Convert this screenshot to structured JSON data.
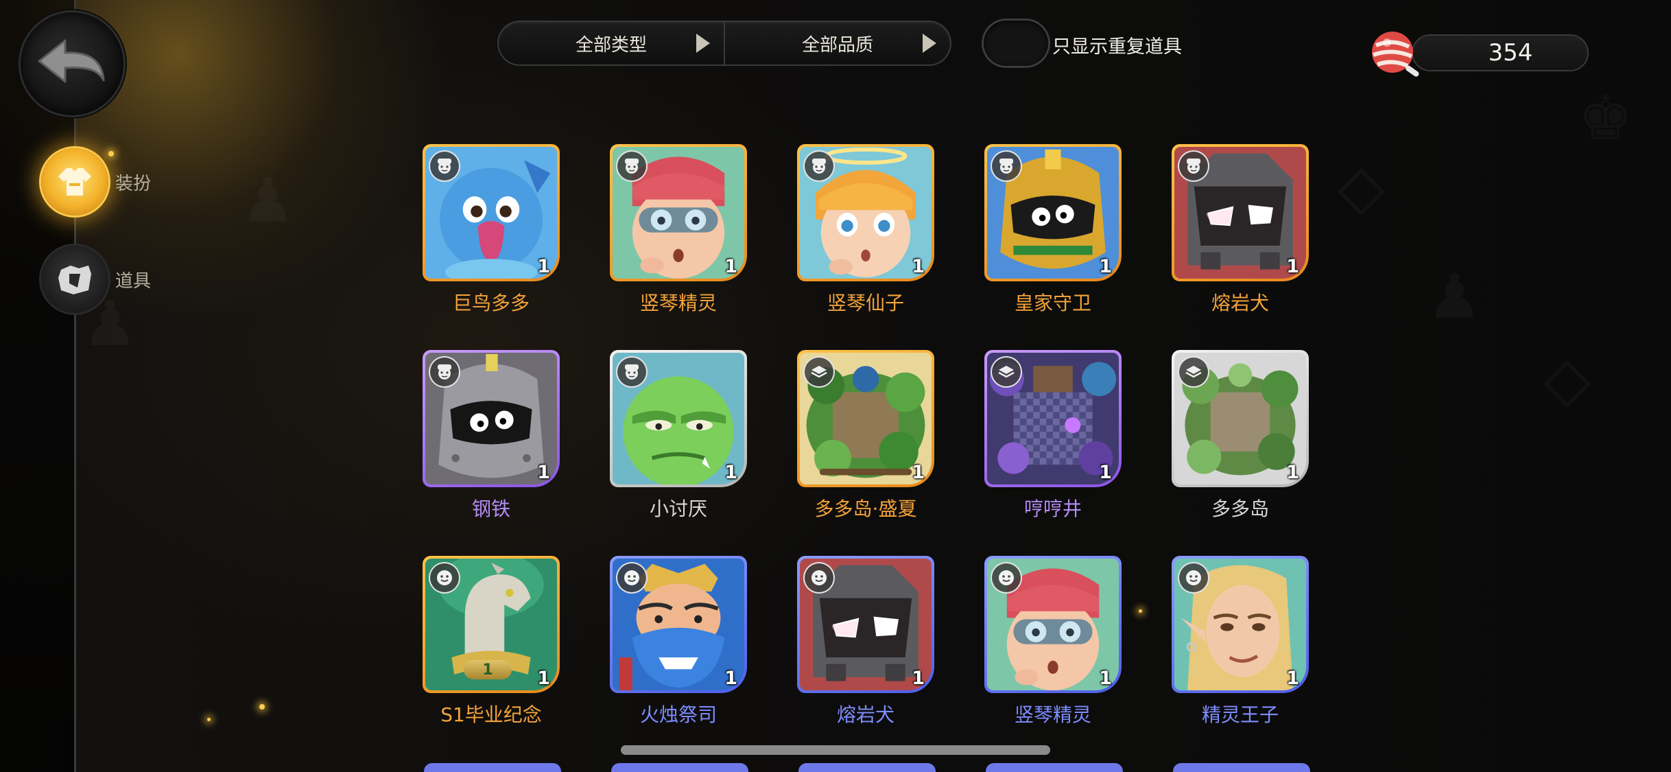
{
  "filters": {
    "type_label": "全部类型",
    "quality_label": "全部品质",
    "duplicate_toggle_label": "只显示重复道具",
    "duplicate_toggle_on": false
  },
  "currency": {
    "icon": "candy-icon",
    "value": "354"
  },
  "sidebar": {
    "items": [
      {
        "label": "装扮",
        "icon": "outfit-icon",
        "active": true
      },
      {
        "label": "道具",
        "icon": "item-bag-icon",
        "active": false
      }
    ]
  },
  "items": [
    {
      "name": "巨鸟多多",
      "count": "1",
      "quality": "orange",
      "badge": "avatar-face-icon",
      "art": "blue-bird"
    },
    {
      "name": "竖琴精灵",
      "count": "1",
      "quality": "orange",
      "badge": "avatar-face-icon",
      "art": "red-hair-elf"
    },
    {
      "name": "竖琴仙子",
      "count": "1",
      "quality": "orange",
      "badge": "avatar-face-icon",
      "art": "blonde-fairy"
    },
    {
      "name": "皇家守卫",
      "count": "1",
      "quality": "orange",
      "badge": "avatar-face-icon",
      "art": "gold-knight"
    },
    {
      "name": "熔岩犬",
      "count": "1",
      "quality": "orange",
      "badge": "avatar-face-icon",
      "art": "lava-hound"
    },
    {
      "name": "钢铁",
      "count": "1",
      "quality": "purple",
      "badge": "avatar-face-icon",
      "art": "steel-knight"
    },
    {
      "name": "小讨厌",
      "count": "1",
      "quality": "white",
      "badge": "avatar-face-icon",
      "art": "green-goblin"
    },
    {
      "name": "多多岛·盛夏",
      "count": "1",
      "quality": "orange",
      "badge": "board-layers-icon",
      "art": "summer-island"
    },
    {
      "name": "哼哼井",
      "count": "1",
      "quality": "purple",
      "badge": "board-layers-icon",
      "art": "crystal-well"
    },
    {
      "name": "多多岛",
      "count": "1",
      "quality": "white",
      "badge": "board-layers-icon",
      "art": "jungle-island"
    },
    {
      "name": "S1毕业纪念",
      "count": "1",
      "quality": "orange",
      "badge": "emote-face-icon",
      "art": "horse-statue",
      "level": "1"
    },
    {
      "name": "火烛祭司",
      "count": "1",
      "quality": "blue",
      "badge": "emote-face-icon",
      "art": "blue-beard"
    },
    {
      "name": "熔岩犬",
      "count": "1",
      "quality": "blue",
      "badge": "emote-face-icon",
      "art": "lava-hound"
    },
    {
      "name": "竖琴精灵",
      "count": "1",
      "quality": "blue",
      "badge": "emote-face-icon",
      "art": "red-hair-elf"
    },
    {
      "name": "精灵王子",
      "count": "1",
      "quality": "blue",
      "badge": "emote-face-icon",
      "art": "elf-prince"
    }
  ]
}
